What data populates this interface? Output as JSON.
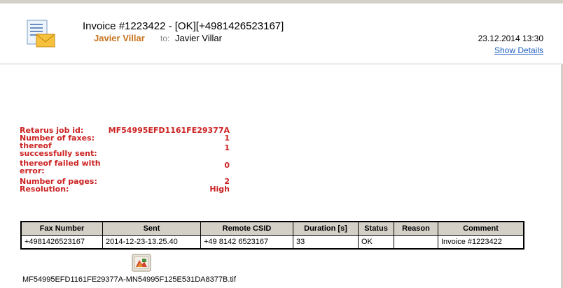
{
  "header": {
    "subject": "Invoice #1223422 - [OK][+4981426523167]",
    "from": "Javier Villar",
    "to_label": "to:",
    "to": "Javier Villar",
    "date": "23.12.2014 13:30",
    "show_details": "Show Details",
    "icon": "envelope-document-icon"
  },
  "report": {
    "job_id_label": "Retarus job id:",
    "job_id": "MF54995EFD1161FE29377A",
    "faxes_label": "Number of faxes:",
    "faxes": "1",
    "sent_label_1": "thereof",
    "sent_label_2": "successfully sent:",
    "sent": "1",
    "failed_label_1": "thereof failed with",
    "failed_label_2": "error:",
    "failed": "0",
    "pages_label": "Number of pages:",
    "pages": "2",
    "resolution_label": "Resolution:",
    "resolution": "High"
  },
  "table": {
    "headers": {
      "fax_number": "Fax Number",
      "sent": "Sent",
      "remote_csid": "Remote CSID",
      "duration": "Duration [s]",
      "status": "Status",
      "reason": "Reason",
      "comment": "Comment"
    },
    "row": {
      "fax_number": "+4981426523167",
      "sent": "2014-12-23-13.25.40",
      "remote_csid": "+49 8142 6523167",
      "duration": "33",
      "status": "OK",
      "reason": "",
      "comment": "Invoice #1223422"
    }
  },
  "attachment": {
    "filename": "MF54995EFD1161FE29377A-MN54995F125E531DA8377B.tif",
    "icon": "tif-image-icon"
  },
  "colors": {
    "sender": "#c8731e",
    "report_text": "#cc2222",
    "link": "#1f5fc4",
    "table_header_bg": "#d4d0c8"
  }
}
